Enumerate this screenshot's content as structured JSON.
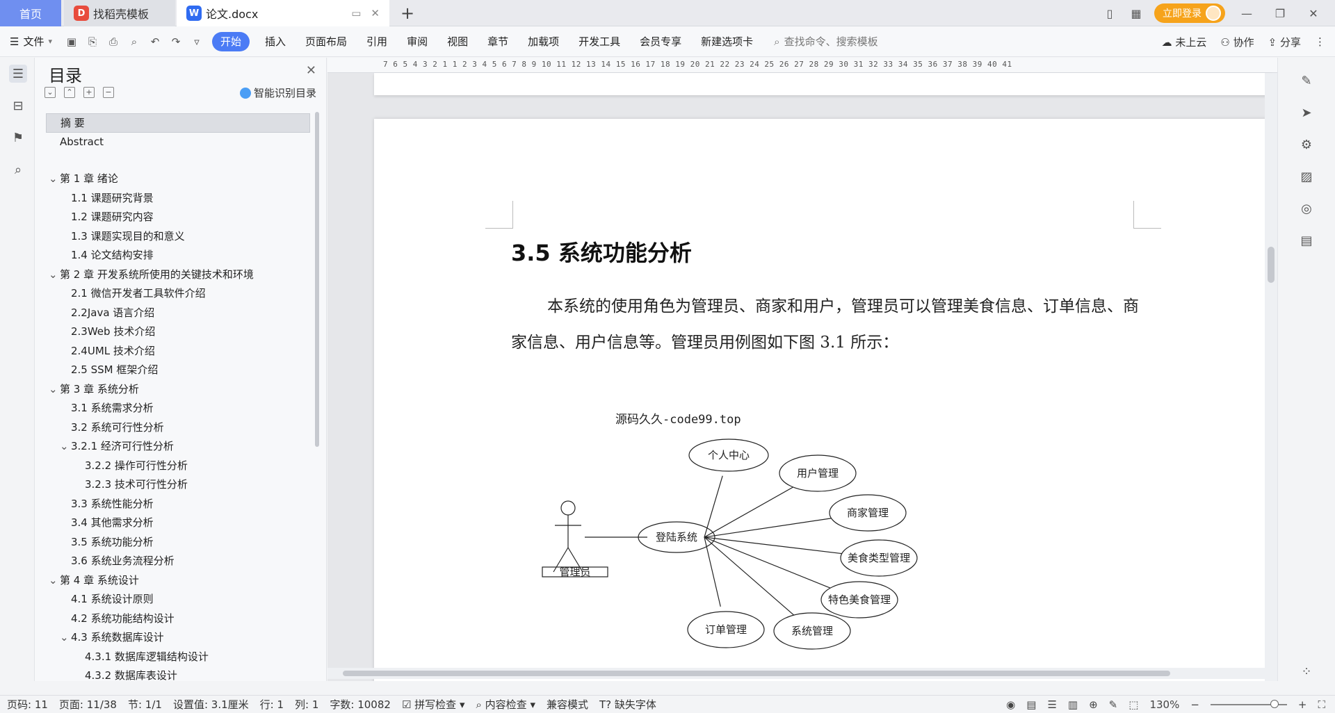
{
  "titlebar": {
    "tabs": [
      {
        "label": "首页"
      },
      {
        "label": "找稻壳模板",
        "icon": "wps-docer-icon"
      },
      {
        "label": "论文.docx",
        "icon": "wps-writer-icon"
      }
    ],
    "login_label": "立即登录"
  },
  "ribbon": {
    "file_label": "文件",
    "menu": [
      "开始",
      "插入",
      "页面布局",
      "引用",
      "审阅",
      "视图",
      "章节",
      "加载项",
      "开发工具",
      "会员专享",
      "新建选项卡"
    ],
    "active_menu": "开始",
    "search_placeholder": "查找命令、搜索模板",
    "cloud_label": "未上云",
    "collab_label": "协作",
    "share_label": "分享"
  },
  "toc": {
    "title": "目录",
    "smart_label": "智能识别目录",
    "items": [
      {
        "text": "摘  要",
        "level": 1,
        "selected": true
      },
      {
        "text": "Abstract",
        "level": 1
      },
      {
        "text": "第 1 章  绪论",
        "level": 1,
        "expanded": true
      },
      {
        "text": "1.1 课题研究背景",
        "level": 2
      },
      {
        "text": "1.2 课题研究内容",
        "level": 2
      },
      {
        "text": "1.3 课题实现目的和意义",
        "level": 2
      },
      {
        "text": "1.4 论文结构安排",
        "level": 2
      },
      {
        "text": "第 2 章  开发系统所使用的关键技术和环境",
        "level": 1,
        "expanded": true
      },
      {
        "text": "2.1 微信开发者工具软件介绍",
        "level": 2
      },
      {
        "text": "2.2Java 语言介绍",
        "level": 2
      },
      {
        "text": "2.3Web 技术介绍",
        "level": 2
      },
      {
        "text": "2.4UML 技术介绍",
        "level": 2
      },
      {
        "text": "2.5 SSM 框架介绍",
        "level": 2
      },
      {
        "text": "第 3 章  系统分析",
        "level": 1,
        "expanded": true
      },
      {
        "text": "3.1 系统需求分析",
        "level": 2
      },
      {
        "text": "3.2 系统可行性分析",
        "level": 2
      },
      {
        "text": "3.2.1 经济可行性分析",
        "level": 2,
        "expanded": true
      },
      {
        "text": "3.2.2 操作可行性分析",
        "level": 3
      },
      {
        "text": "3.2.3 技术可行性分析",
        "level": 3
      },
      {
        "text": "3.3 系统性能分析",
        "level": 2
      },
      {
        "text": "3.4 其他需求分析",
        "level": 2
      },
      {
        "text": "3.5 系统功能分析",
        "level": 2
      },
      {
        "text": "3.6 系统业务流程分析",
        "level": 2
      },
      {
        "text": "第 4 章  系统设计",
        "level": 1,
        "expanded": true
      },
      {
        "text": "4.1 系统设计原则",
        "level": 2
      },
      {
        "text": "4.2 系统功能结构设计",
        "level": 2
      },
      {
        "text": "4.3 系统数据库设计",
        "level": 2,
        "expanded": true
      },
      {
        "text": "4.3.1 数据库逻辑结构设计",
        "level": 3
      },
      {
        "text": "4.3.2 数据库表设计",
        "level": 3
      }
    ]
  },
  "ruler": {
    "ticks": "7  6  5  4  3  2  1     1  2  3  4  5  6  7  8  9  10 11 12 13 14 15 16 17 18 19 20 21 22 23 24 25 26 27 28 29 30 31 32 33 34 35 36 37 38 39 40 41"
  },
  "document": {
    "heading": "3.5 系统功能分析",
    "paragraph": "本系统的使用角色为管理员、商家和用户，管理员可以管理美食信息、订单信息、商家信息、用户信息等。管理员用例图如下图 3.1 所示：",
    "watermark": "源码久久-code99.top",
    "diagram": {
      "actor": "管理员",
      "center": "登陆系统",
      "use_cases": [
        "个人中心",
        "用户管理",
        "商家管理",
        "美食类型管理",
        "特色美食管理",
        "系统管理",
        "订单管理"
      ]
    }
  },
  "status": {
    "page_code": "页码: 11",
    "page": "页面: 11/38",
    "section": "节: 1/1",
    "setting": "设置值: 3.1厘米",
    "row": "行: 1",
    "col": "列: 1",
    "word_count": "字数: 10082",
    "spell_check": "拼写检查",
    "content_check": "内容检查",
    "compat_mode": "兼容模式",
    "missing_font": "缺失字体",
    "zoom": "130%"
  }
}
